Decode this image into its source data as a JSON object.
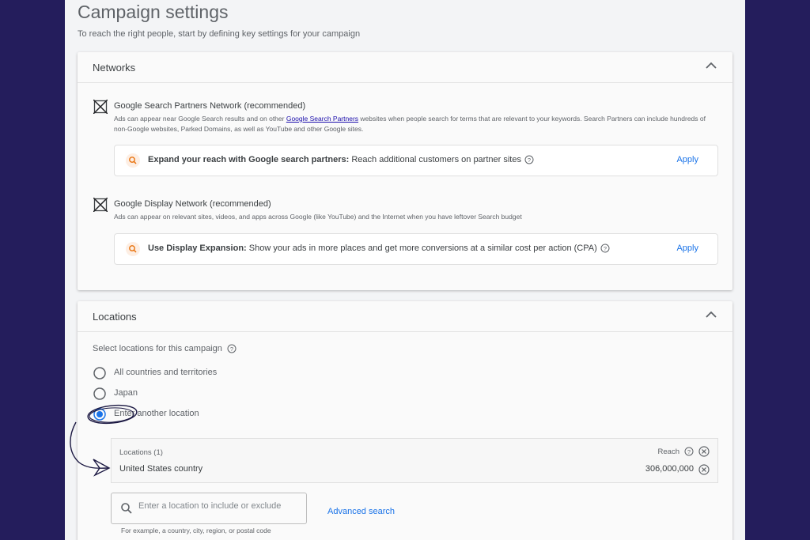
{
  "page": {
    "title": "Campaign settings",
    "subtitle": "To reach the right people, start by defining key settings for your campaign"
  },
  "networks": {
    "title": "Networks",
    "search_partners": {
      "label": "Google Search Partners Network (recommended)",
      "desc_before": "Ads can appear near Google Search results and on other ",
      "desc_link": "Google Search Partners",
      "desc_after": " websites when people search for terms that are relevant to your keywords. Search Partners can include hundreds of non-Google websites, Parked Domains, as well as YouTube and other Google sites.",
      "suggestion_bold": "Expand your reach with Google search partners:",
      "suggestion_text": " Reach additional customers on partner sites",
      "apply_label": "Apply"
    },
    "display": {
      "label": "Google Display Network (recommended)",
      "desc": "Ads can appear on relevant sites, videos, and apps across Google (like YouTube) and the Internet when you have leftover Search budget",
      "suggestion_bold": "Use Display Expansion:",
      "suggestion_text": " Show your ads in more places and get more conversions at a similar cost per action (CPA)",
      "apply_label": "Apply"
    }
  },
  "locations": {
    "title": "Locations",
    "prompt": "Select locations for this campaign",
    "options": [
      {
        "label": "All countries and territories",
        "selected": false
      },
      {
        "label": "Japan",
        "selected": false
      },
      {
        "label": "Enter another location",
        "selected": true
      }
    ],
    "table": {
      "count_label": "Locations (1)",
      "reach_label": "Reach",
      "rows": [
        {
          "name": "United States country",
          "reach": "306,000,000"
        }
      ]
    },
    "search": {
      "placeholder": "Enter a location to include or exclude",
      "hint": "For example, a country, city, region, or postal code"
    },
    "advanced_search": "Advanced search"
  },
  "colors": {
    "background": "#241d5c",
    "accent": "#1a73e8",
    "link": "#1a0dab"
  }
}
